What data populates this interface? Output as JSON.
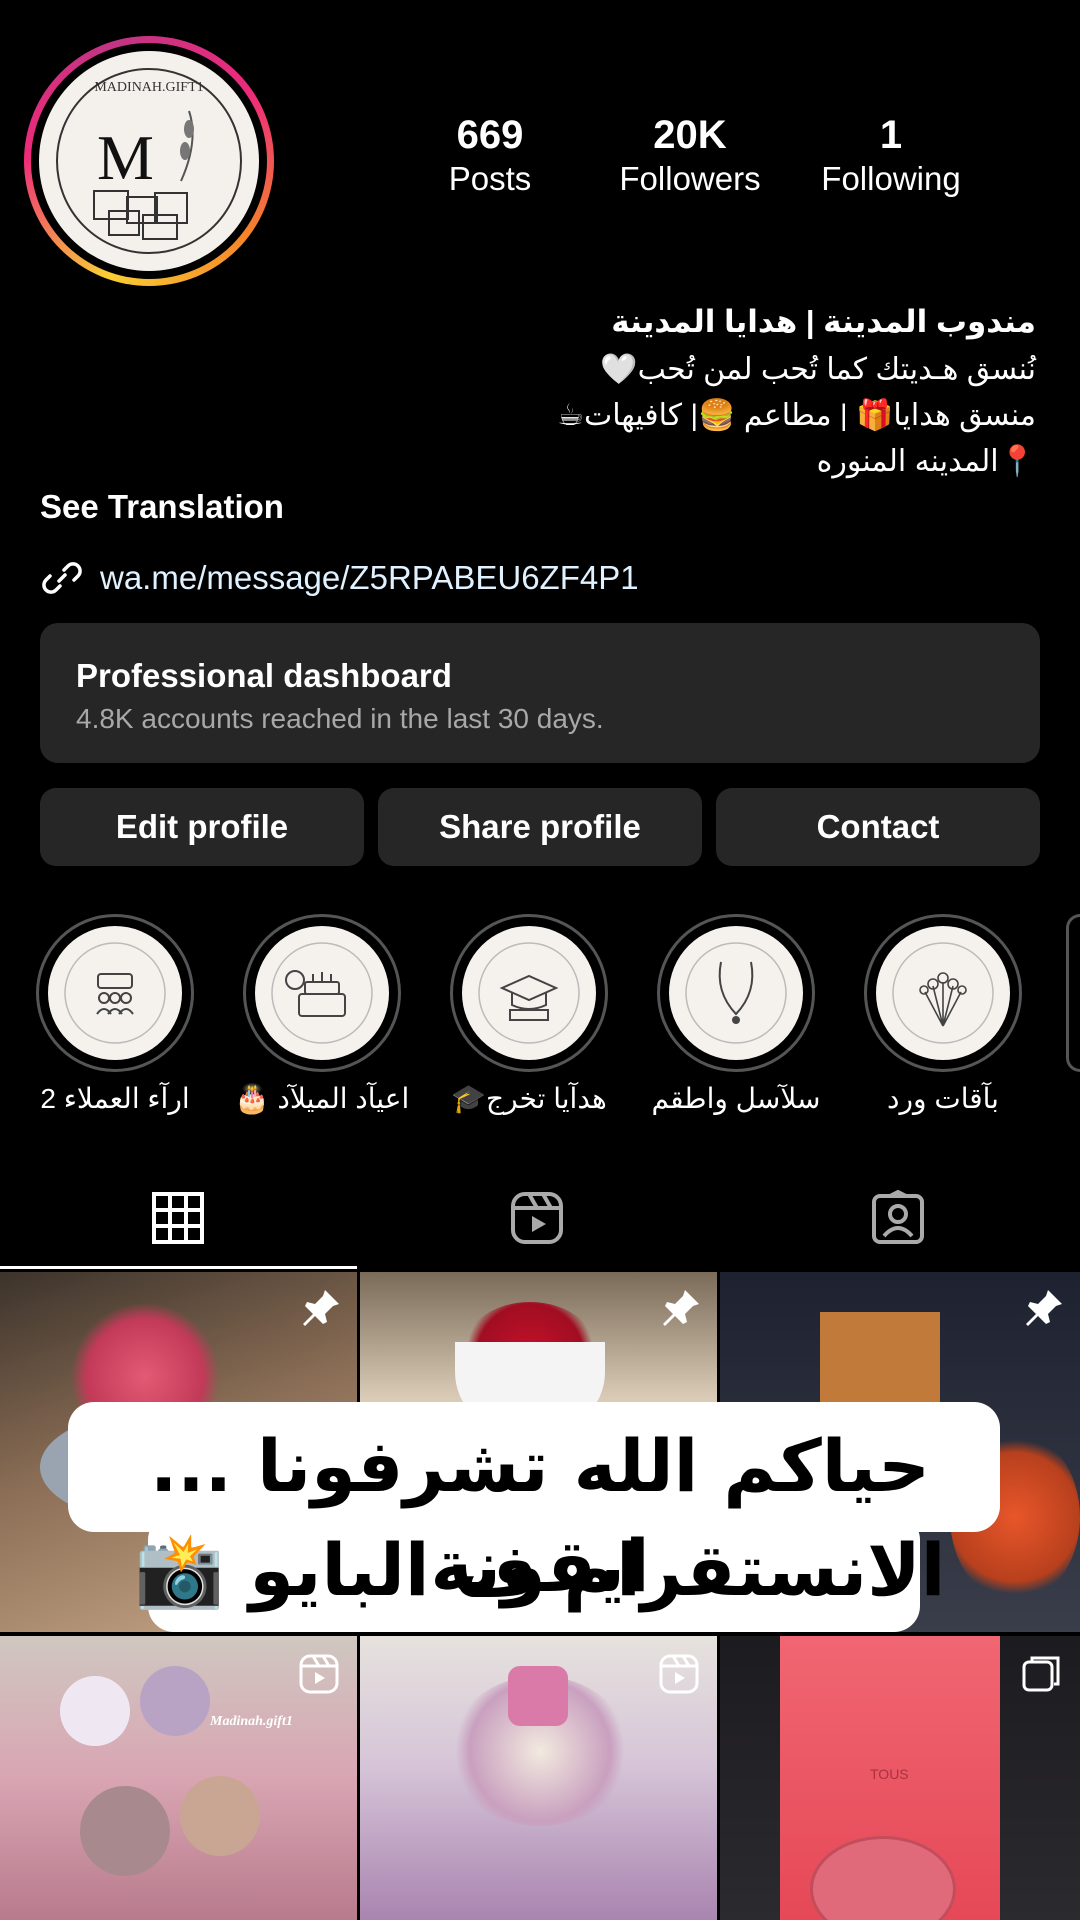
{
  "profile": {
    "avatar_brand": "MADINAH.GIFT1",
    "avatar_letter": "M"
  },
  "stats": [
    {
      "value": "669",
      "label": "Posts"
    },
    {
      "value": "20K",
      "label": "Followers"
    },
    {
      "value": "1",
      "label": "Following"
    }
  ],
  "bio": {
    "name": "مندوب المدينة | هدايا المدينة",
    "line1": "نُنسق هـديتك كما تُحب لمن تُحب🤍",
    "line2": "منسق هدايا🎁 | مطاعم 🍔| كافيهات☕",
    "line3": "📍المدينه المنوره",
    "see_translation": "See Translation",
    "link": "wa.me/message/Z5RPABEU6ZF4P1"
  },
  "dashboard": {
    "title": "Professional dashboard",
    "subtitle": "4.8K accounts reached in the last 30 days."
  },
  "buttons": {
    "edit": "Edit profile",
    "share": "Share profile",
    "contact": "Contact"
  },
  "highlights": [
    {
      "label": "ارآء العملاء 2",
      "icon": "people-icon"
    },
    {
      "label": "اعيآد الميلآد 🎂",
      "icon": "cake-icon"
    },
    {
      "label": "هدآيا تخرج🎓",
      "icon": "graduation-cap-icon"
    },
    {
      "label": "سلآسل واطقم",
      "icon": "necklace-icon"
    },
    {
      "label": "بآقات ورد",
      "icon": "flowers-icon"
    }
  ],
  "tabs": [
    "grid-icon",
    "reels-icon",
    "tagged-icon"
  ],
  "overlay": {
    "line1": "حياكم الله تشرفونا ... ايقونة",
    "line2": "الانستقرام ف البايو 📸"
  },
  "posts": {
    "watermark": "Madinah.gift1",
    "bag_brand": "TOUS"
  },
  "colors": {
    "background": "#000000",
    "card": "#262626",
    "link": "#e0f1ff",
    "muted": "#a8a8a8"
  }
}
